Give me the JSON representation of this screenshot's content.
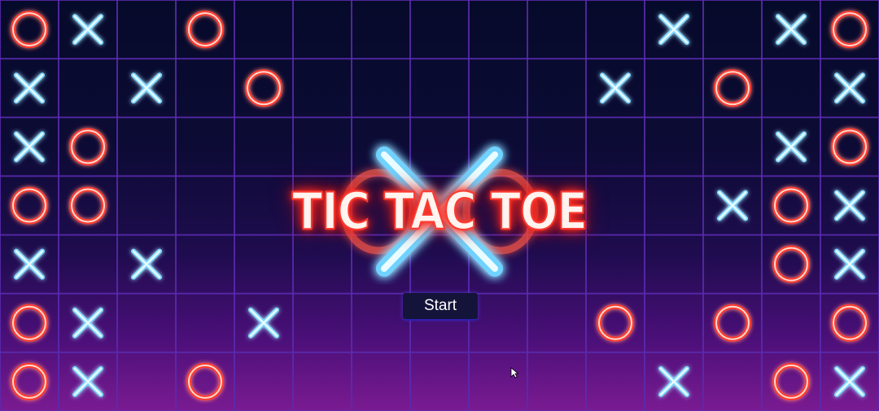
{
  "game": {
    "title": "TIC TAC TOE",
    "start_label": "Start"
  },
  "board": {
    "rows": 7,
    "cols": 15,
    "cells": [
      "O",
      "X",
      "",
      "O",
      "",
      "",
      "",
      "",
      "",
      "",
      "",
      "X",
      "",
      "X",
      "O",
      "X",
      "",
      "X",
      "",
      "O",
      "",
      "",
      "",
      "",
      "",
      "X",
      "",
      "O",
      "",
      "X",
      "X",
      "O",
      "",
      "",
      "",
      "",
      "",
      "",
      "",
      "",
      "",
      "",
      "",
      "X",
      "O",
      "O",
      "O",
      "",
      "",
      "",
      "",
      "",
      "",
      "",
      "",
      "",
      "",
      "X",
      "O",
      "X",
      "X",
      "",
      "X",
      "",
      "",
      "",
      "",
      "",
      "",
      "",
      "",
      "",
      "",
      "O",
      "X",
      "O",
      "X",
      "",
      "",
      "X",
      "",
      "",
      "",
      "",
      "",
      "O",
      "",
      "O",
      "",
      "O",
      "O",
      "X",
      "",
      "O",
      "",
      "",
      "",
      "",
      "",
      "",
      "",
      "X",
      "",
      "O",
      "X"
    ]
  },
  "colors": {
    "x_glow": "#7fd8ff",
    "x_core": "#e8fbff",
    "o_glow": "#ff3b2f",
    "o_core": "#ffd9cf",
    "grid": "#5a2bb0",
    "background_top": "#060a2a",
    "background_bottom": "#7a1b92"
  },
  "icons": {
    "x_mark": "x-mark-icon",
    "o_mark": "o-mark-icon",
    "cursor": "mouse-pointer-icon"
  }
}
